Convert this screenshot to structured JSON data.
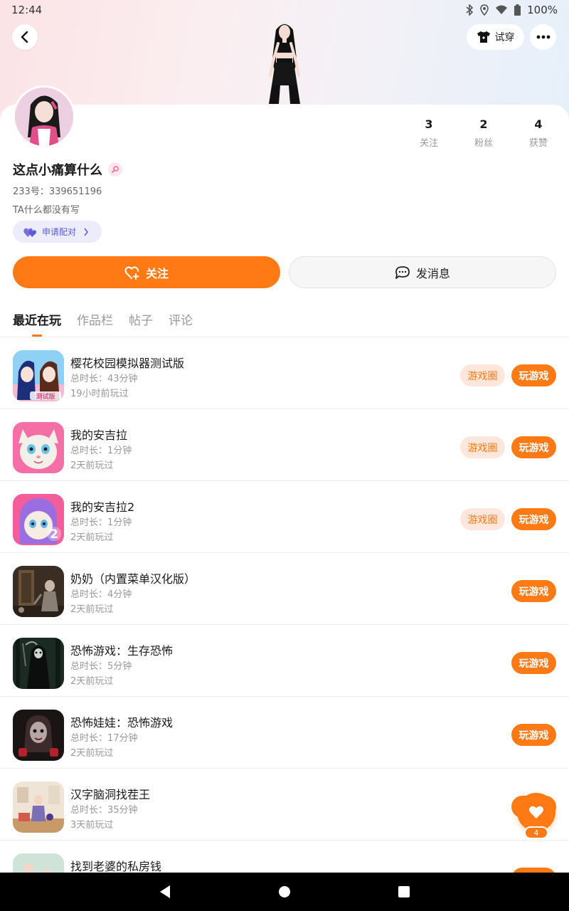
{
  "status_bar": {
    "time": "12:44",
    "battery": "100%"
  },
  "header": {
    "tryon_label": "试穿"
  },
  "profile": {
    "username": "这点小痛算什么",
    "uid": "233号：339651196",
    "bio": "TA什么都没有写",
    "pair_label": "申请配对",
    "stats": [
      {
        "value": "3",
        "label": "关注"
      },
      {
        "value": "2",
        "label": "粉丝"
      },
      {
        "value": "4",
        "label": "获赞"
      }
    ]
  },
  "actions": {
    "follow_label": "关注",
    "message_label": "发消息"
  },
  "tabs": [
    {
      "label": "最近在玩",
      "active": true
    },
    {
      "label": "作品栏",
      "active": false
    },
    {
      "label": "帖子",
      "active": false
    },
    {
      "label": "评论",
      "active": false
    }
  ],
  "buttons": {
    "circle_label": "游戏圈",
    "play_label": "玩游戏"
  },
  "games": [
    {
      "title": "樱花校园模拟器测试版",
      "duration": "总时长：43分钟",
      "last_played": "19小时前玩过",
      "has_circle": true
    },
    {
      "title": "我的安吉拉",
      "duration": "总时长：1分钟",
      "last_played": "2天前玩过",
      "has_circle": true
    },
    {
      "title": "我的安吉拉2",
      "duration": "总时长：1分钟",
      "last_played": "2天前玩过",
      "has_circle": true
    },
    {
      "title": "奶奶（内置菜单汉化版）",
      "duration": "总时长：4分钟",
      "last_played": "2天前玩过",
      "has_circle": false
    },
    {
      "title": "恐怖游戏：生存恐怖",
      "duration": "总时长：5分钟",
      "last_played": "2天前玩过",
      "has_circle": false
    },
    {
      "title": "恐怖娃娃：恐怖游戏",
      "duration": "总时长：17分钟",
      "last_played": "2天前玩过",
      "has_circle": false
    },
    {
      "title": "汉字脑洞找茬王",
      "duration": "总时长：35分钟",
      "last_played": "3天前玩过",
      "has_circle": false
    },
    {
      "title": "找到老婆的私房钱",
      "duration": "",
      "last_played": "",
      "has_circle": false
    }
  ],
  "game_icon_badges": {
    "sakura": "测试版",
    "angela2": "2"
  },
  "fab": {
    "count": "4"
  },
  "colors": {
    "accent": "#ff7a14",
    "accent_light": "#fde7dc",
    "pair": "#5b5bd6"
  }
}
